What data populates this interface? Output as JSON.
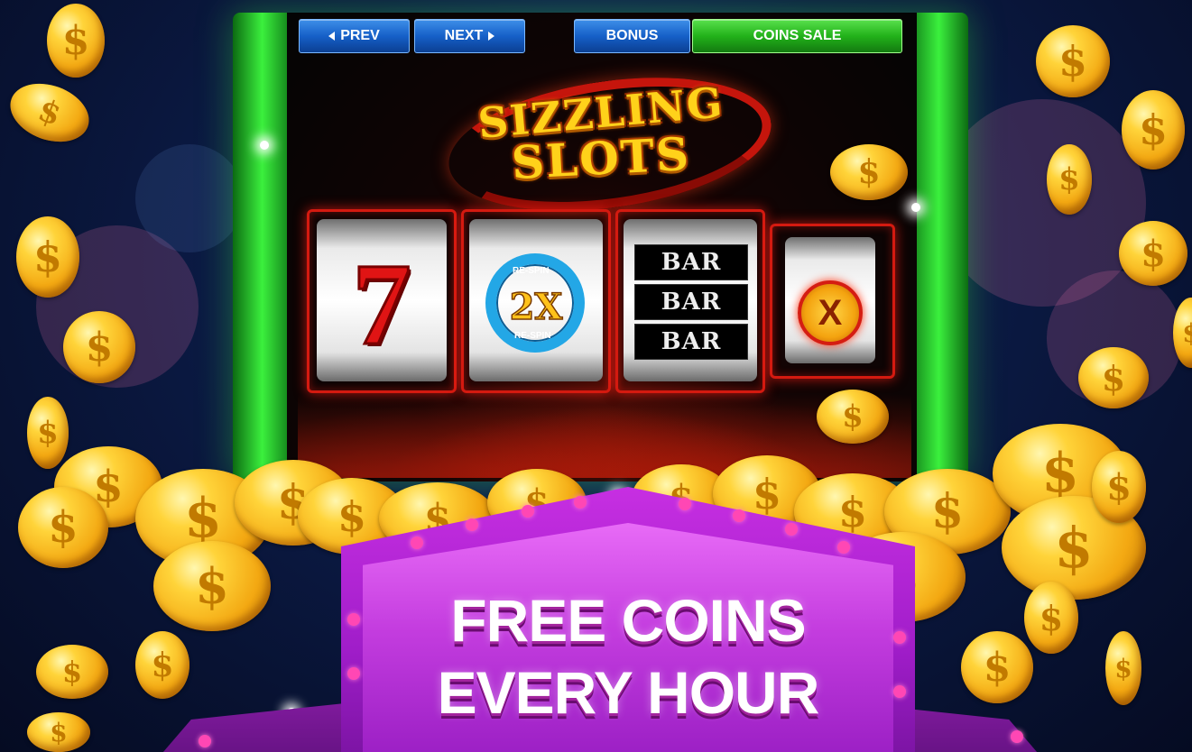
{
  "nav": {
    "prev_label": "PREV",
    "next_label": "NEXT",
    "bonus_label": "BONUS",
    "coins_sale_label": "COINS SALE"
  },
  "logo": {
    "line1": "SIZZLING",
    "line2": "SLOTS"
  },
  "reels": {
    "reel1_symbol": "7",
    "reel2_symbol": "2X",
    "reel2_top_text": "RE-SPIN",
    "reel2_bottom_text": "RE-SPIN",
    "reel3_rows": [
      "BAR",
      "BAR",
      "BAR"
    ],
    "reel4_symbol": "X"
  },
  "banner": {
    "line1": "FREE COINS",
    "line2": "EVERY HOUR"
  },
  "icons": {
    "coin": "$"
  },
  "colors": {
    "cabinet_green": "#3bf03d",
    "reel_border_red": "#d41a10",
    "button_blue": "#1660c8",
    "button_green": "#22b21a",
    "banner_purple": "#a01dc9",
    "coin_gold": "#f3a812"
  }
}
